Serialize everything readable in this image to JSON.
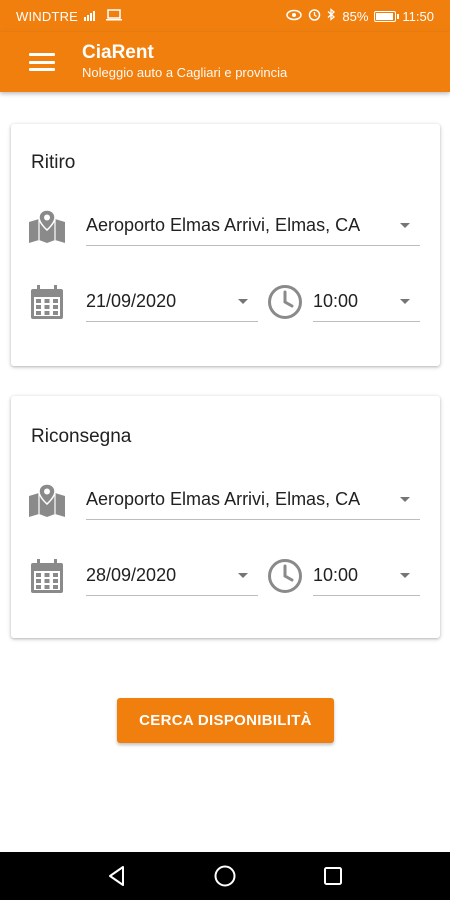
{
  "status": {
    "carrier": "WINDTRE",
    "battery_pct": "85%",
    "battery_level": 0.85,
    "time": "11:50"
  },
  "appbar": {
    "title": "CiaRent",
    "subtitle": "Noleggio auto a Cagliari e provincia"
  },
  "pickup": {
    "heading": "Ritiro",
    "location": "Aeroporto Elmas Arrivi, Elmas, CA",
    "date": "21/09/2020",
    "time": "10:00"
  },
  "return": {
    "heading": "Riconsegna",
    "location": "Aeroporto Elmas Arrivi, Elmas, CA",
    "date": "28/09/2020",
    "time": "10:00"
  },
  "actions": {
    "search_label": "CERCA DISPONIBILITÀ"
  },
  "colors": {
    "primary": "#f07f0e",
    "icon_grey": "#8a8a8a"
  },
  "icons": {
    "menu": "hamburger-menu-icon",
    "location": "map-icon",
    "date": "calendar-icon",
    "time": "clock-icon",
    "nav": [
      "back-icon",
      "home-icon",
      "recents-icon"
    ]
  }
}
